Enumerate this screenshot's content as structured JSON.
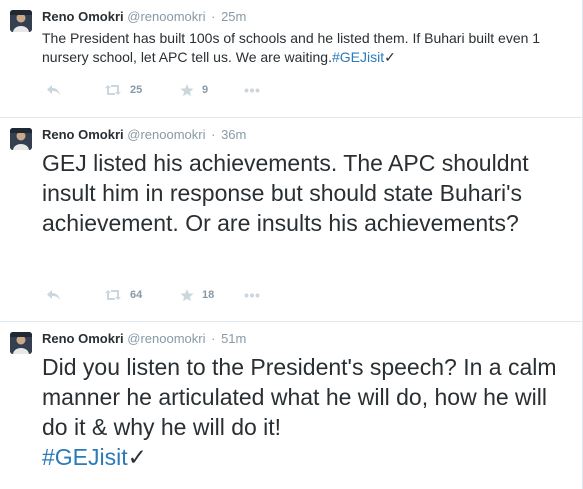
{
  "tweets": [
    {
      "name": "Reno Omokri",
      "handle": "@renoomokri",
      "separator": "·",
      "time": "25m",
      "text": "The President has built 100s of schools and he listed them. If Buhari built even 1 nursery school, let APC tell us. We are waiting.",
      "hashtag": "#GEJisit",
      "check": "✓",
      "retweets": "25",
      "favorites": "9"
    },
    {
      "name": "Reno Omokri",
      "handle": "@renoomokri",
      "separator": "·",
      "time": "36m",
      "text": "GEJ listed his achievements. The APC shouldnt insult him in response but should state Buhari's achievement. Or are insults his achievements?",
      "hashtag": "",
      "check": "",
      "retweets": "64",
      "favorites": "18"
    },
    {
      "name": "Reno Omokri",
      "handle": "@renoomokri",
      "separator": "·",
      "time": "51m",
      "text": "Did you listen to the President's speech? In a calm manner he articulated what he will do, how he will do it & why he will do it!",
      "hashtag": "#GEJisit",
      "check": "✓",
      "retweets": "",
      "favorites": ""
    }
  ],
  "colors": {
    "link": "#2b7bb9",
    "meta": "#8899a6",
    "text": "#292f33",
    "divider": "#e1e8ed"
  },
  "icons": [
    "avatar",
    "reply-icon",
    "retweet-icon",
    "favorite-icon",
    "more-icon"
  ]
}
